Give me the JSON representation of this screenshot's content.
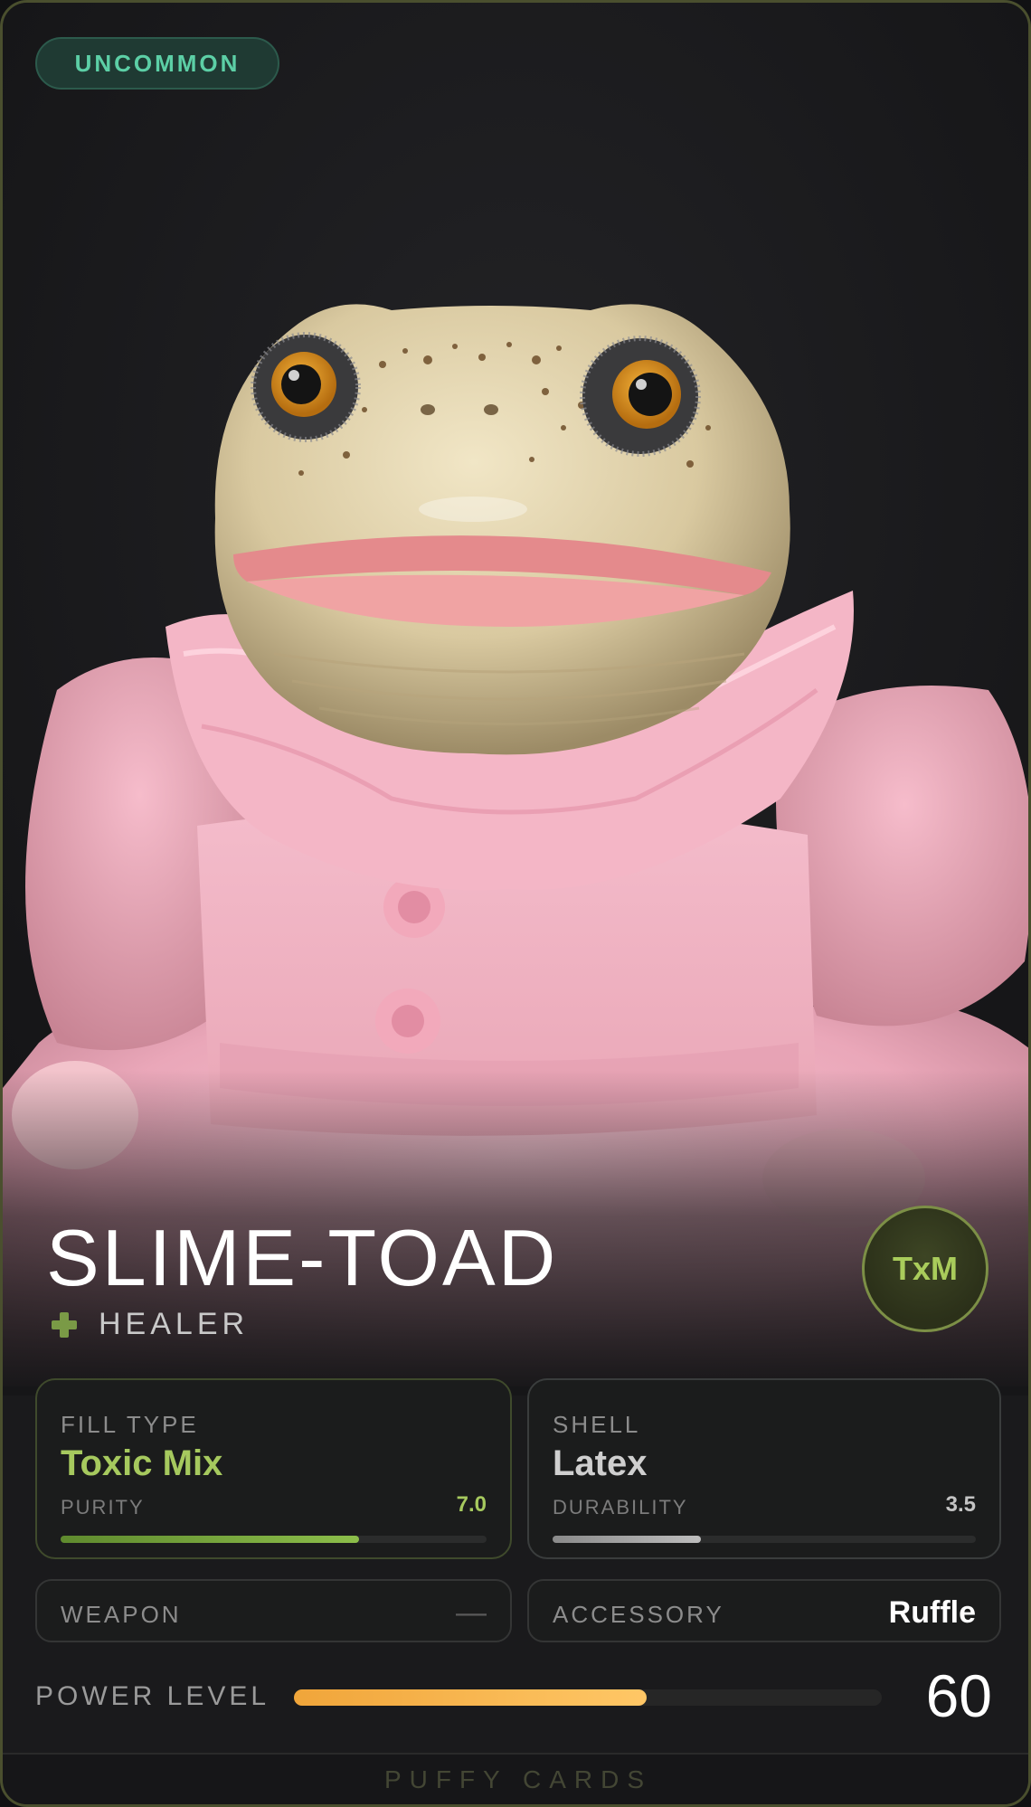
{
  "card": {
    "rarity": "UNCOMMON",
    "name": "SLIME-TOAD",
    "class_label": "HEALER",
    "class_icon": "cross-icon",
    "maker_badge": "TxM",
    "brand": "PUFFY CARDS"
  },
  "stats": {
    "fill": {
      "label": "FILL TYPE",
      "value": "Toxic Mix",
      "sub_label": "PURITY",
      "sub_value": "7.0",
      "level": 0.7
    },
    "shell": {
      "label": "SHELL",
      "value": "Latex",
      "sub_label": "DURABILITY",
      "sub_value": "3.5",
      "level": 0.35
    },
    "weapon": {
      "label": "WEAPON",
      "value": "—"
    },
    "accessory": {
      "label": "ACCESSORY",
      "value": "Ruffle"
    }
  },
  "power": {
    "label": "POWER LEVEL",
    "value": "60",
    "level": 0.6
  },
  "colors": {
    "rarity_text": "#5ccfa6",
    "fill_accent": "#a6c95e",
    "power_bar": "#f0a53a",
    "card_border": "#4a4f2e"
  }
}
